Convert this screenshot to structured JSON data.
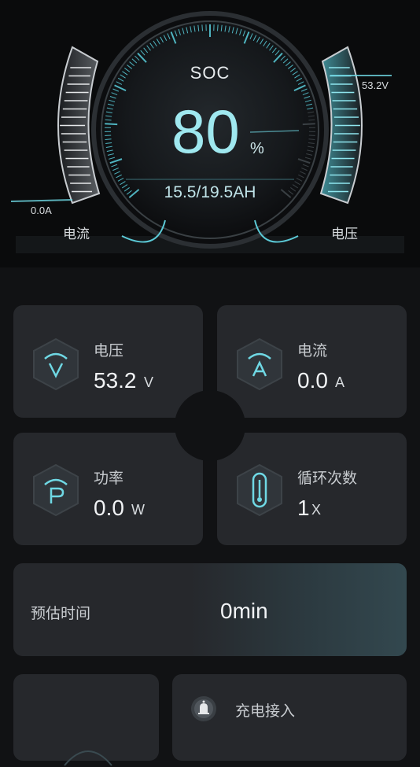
{
  "gauge": {
    "title": "SOC",
    "value": "80",
    "unit": "%",
    "capacity": "15.5/19.5AH",
    "left_readout": "0.0A",
    "left_label": "电流",
    "right_readout": "53.2V",
    "right_label": "电压",
    "soc_percent": 80
  },
  "cards": [
    {
      "label": "电压",
      "value": "53.2",
      "unit": "V",
      "icon": "voltage-icon"
    },
    {
      "label": "电流",
      "value": "0.0",
      "unit": "A",
      "icon": "current-icon"
    },
    {
      "label": "功率",
      "value": "0.0",
      "unit": "W",
      "icon": "power-icon"
    },
    {
      "label": "循环次数",
      "value": "1",
      "unit": "X",
      "icon": "thermometer-icon"
    }
  ],
  "estimate": {
    "label": "预估时间",
    "value": "0min"
  },
  "charging": {
    "label": "充电接入",
    "icon": "bell-icon"
  },
  "colors": {
    "accent": "#6fd8e4",
    "card": "#26282c",
    "background": "#111214"
  }
}
